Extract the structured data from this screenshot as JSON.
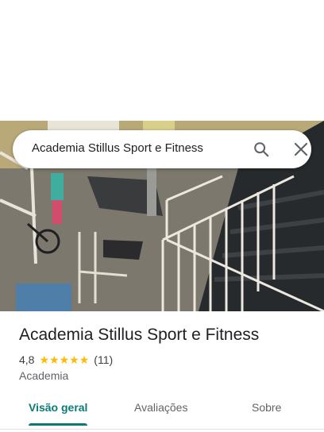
{
  "search": {
    "query": "Academia Stillus Sport e Fitness",
    "search_icon": "search-icon",
    "close_icon": "close-icon"
  },
  "hero": {
    "image_description_icon": "gym-photo"
  },
  "place": {
    "title": "Academia Stillus Sport e Fitness",
    "rating": "4,8",
    "stars": 5,
    "review_count": "(11)",
    "category": "Academia"
  },
  "tabs": [
    {
      "label": "Visão geral",
      "active": true
    },
    {
      "label": "Avaliações",
      "active": false
    },
    {
      "label": "Sobre",
      "active": false
    }
  ],
  "colors": {
    "accent": "#0b7a75",
    "star": "#fbbc04",
    "text_primary": "#202124",
    "text_secondary": "#5f6368"
  }
}
